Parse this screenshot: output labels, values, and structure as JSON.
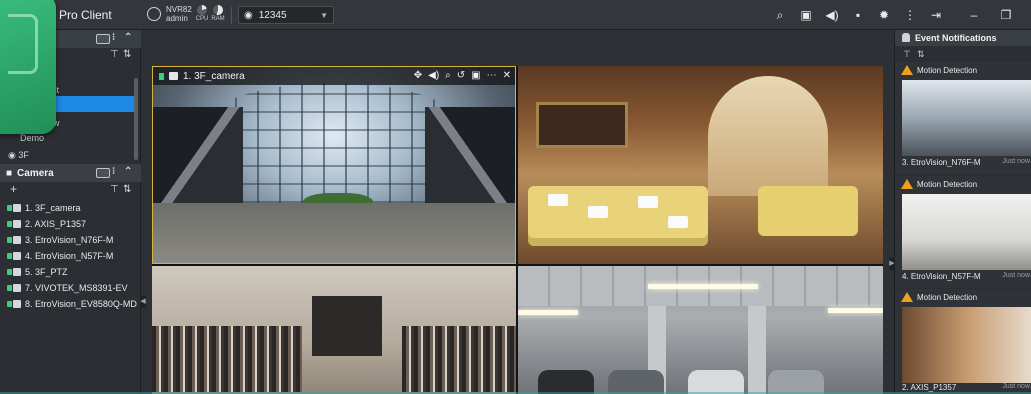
{
  "app": {
    "title": "Pro Client"
  },
  "topbar": {
    "nvr_name": "NVR82",
    "nvr_user": "admin",
    "cpu_label": "CPU",
    "ram_label": "RAM",
    "live_select_value": "12345"
  },
  "left_panel": {
    "views_section": {
      "items": [
        {
          "label": "st"
        },
        {
          "label": "ew"
        },
        {
          "label": "Demo"
        },
        {
          "label": "3F"
        }
      ]
    },
    "camera_section": {
      "title": "Camera",
      "cameras": [
        {
          "label": "1. 3F_camera"
        },
        {
          "label": "2. AXIS_P1357"
        },
        {
          "label": "3. EtroVision_N76F-M"
        },
        {
          "label": "4. EtroVision_N57F-M"
        },
        {
          "label": "5. 3F_PTZ"
        },
        {
          "label": "7. VIVOTEK_MS8391-EV"
        },
        {
          "label": "8. EtroVision_EV8580Q-MD"
        }
      ]
    }
  },
  "grid": {
    "tiles": [
      {
        "title": "1. 3F_camera",
        "selected": true
      }
    ]
  },
  "right_panel": {
    "title": "Event Notifications",
    "events": [
      {
        "type": "Motion Detection",
        "camera": "3. EtroVision_N76F-M",
        "time": "Just now"
      },
      {
        "type": "Motion Detection",
        "camera": "4. EtroVision_N57F-M",
        "time": "Just now"
      },
      {
        "type": "Motion Detection",
        "camera": "2. AXIS_P1357",
        "time": "Just now"
      }
    ]
  },
  "colors": {
    "accent_blue": "#1e88e5",
    "record_green": "#3ccf7a",
    "selected_tile_border": "#d6b33a",
    "warning": "#f0a020",
    "logo_green": "#2fae6b"
  }
}
